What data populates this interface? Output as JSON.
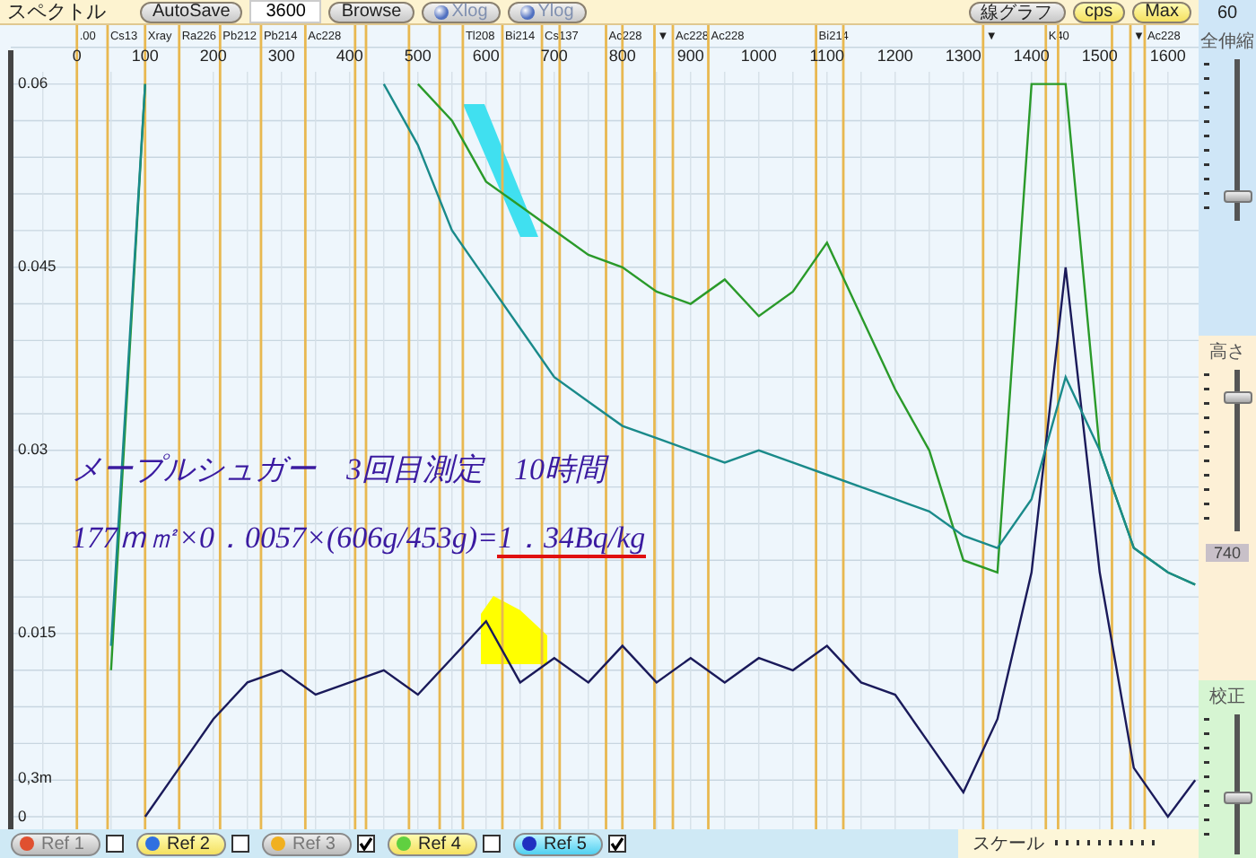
{
  "toolbar": {
    "title": "スペクトル",
    "controls": [
      {
        "kind": "button",
        "label": "AutoSave"
      },
      {
        "kind": "field",
        "value": "3600"
      },
      {
        "kind": "button",
        "label": "Browse"
      },
      {
        "kind": "radio",
        "label": "Xlog",
        "on": false
      },
      {
        "kind": "radio",
        "label": "Ylog",
        "on": false
      }
    ],
    "toggles": [
      {
        "label": "線グラフ",
        "on": false
      },
      {
        "label": "cps",
        "on": true
      },
      {
        "label": "Max",
        "on": true
      }
    ]
  },
  "spectrum": {
    "chart_data": {
      "type": "line",
      "grid": true,
      "x": [
        50,
        100,
        150,
        200,
        250,
        300,
        350,
        400,
        450,
        500,
        550,
        600,
        650,
        700,
        750,
        800,
        850,
        900,
        950,
        1000,
        1050,
        1100,
        1150,
        1200,
        1250,
        1300,
        1350,
        1400,
        1450,
        1500,
        1550,
        1600,
        1640
      ],
      "series": [
        {
          "color": "#1a1a5a",
          "values": [
            null,
            0.0,
            0.004,
            0.008,
            0.011,
            0.012,
            0.01,
            0.011,
            0.012,
            0.01,
            0.013,
            0.016,
            0.011,
            0.013,
            0.011,
            0.014,
            0.011,
            0.013,
            0.011,
            0.013,
            0.012,
            0.014,
            0.011,
            0.01,
            0.006,
            0.002,
            0.008,
            0.02,
            0.045,
            0.02,
            0.004,
            0.0,
            0.003
          ]
        },
        {
          "color": "#2a9a2a",
          "values": [
            0.012,
            0.06,
            null,
            null,
            null,
            null,
            null,
            null,
            null,
            0.06,
            0.057,
            0.052,
            0.05,
            0.048,
            0.046,
            0.045,
            0.043,
            0.042,
            0.044,
            0.041,
            0.043,
            0.047,
            0.041,
            0.035,
            0.03,
            0.021,
            0.02,
            0.06,
            0.06,
            0.03,
            0.022,
            0.02,
            0.019
          ]
        },
        {
          "color": "#1a8a8a",
          "values": [
            0.014,
            0.06,
            null,
            null,
            null,
            null,
            null,
            null,
            0.06,
            0.055,
            0.048,
            0.044,
            0.04,
            0.036,
            0.034,
            0.032,
            0.031,
            0.03,
            0.029,
            0.03,
            0.029,
            0.028,
            0.027,
            0.026,
            0.025,
            0.023,
            0.022,
            0.026,
            0.036,
            0.03,
            0.022,
            0.02,
            0.019
          ]
        }
      ],
      "xticks": [
        0,
        100,
        200,
        300,
        400,
        500,
        600,
        700,
        800,
        900,
        1000,
        1100,
        1200,
        1300,
        1400,
        1500,
        1600
      ],
      "yticks": [
        0,
        0.015,
        0.03,
        0.045,
        0.06
      ],
      "xlim": [
        -97,
        1645
      ],
      "ylim": [
        0,
        0.061
      ],
      "ref_lines": [
        {
          "axis": "x",
          "value": 0,
          "label": ".00"
        },
        {
          "axis": "x",
          "value": 45,
          "label": "Cs13"
        },
        {
          "axis": "x",
          "value": 100,
          "label": "Xray"
        },
        {
          "axis": "x",
          "value": 150,
          "label": "Ra226"
        },
        {
          "axis": "x",
          "value": 210,
          "label": "Pb212"
        },
        {
          "axis": "x",
          "value": 270,
          "label": "Pb214"
        },
        {
          "axis": "x",
          "value": 335,
          "label": "Ac228"
        },
        {
          "axis": "x",
          "value": 408
        },
        {
          "axis": "x",
          "value": 424
        },
        {
          "axis": "x",
          "value": 487
        },
        {
          "axis": "x",
          "value": 532
        },
        {
          "axis": "x",
          "value": 566,
          "label": "Tl208"
        },
        {
          "axis": "x",
          "value": 624,
          "label": "Bi214"
        },
        {
          "axis": "x",
          "value": 682,
          "label": "Cs137"
        },
        {
          "axis": "x",
          "value": 708
        },
        {
          "axis": "x",
          "value": 776,
          "label": "Ac228"
        },
        {
          "axis": "x",
          "value": 800
        },
        {
          "axis": "x",
          "value": 847,
          "label": "▼"
        },
        {
          "axis": "x",
          "value": 874,
          "label": "Ac228"
        },
        {
          "axis": "x",
          "value": 926,
          "label": "Ac228"
        },
        {
          "axis": "x",
          "value": 1084,
          "label": "Bi214"
        },
        {
          "axis": "x",
          "value": 1124
        },
        {
          "axis": "x",
          "value": 1329,
          "label": "▼"
        },
        {
          "axis": "x",
          "value": 1421,
          "label": "K40"
        },
        {
          "axis": "x",
          "value": 1439
        },
        {
          "axis": "x",
          "value": 1518
        },
        {
          "axis": "x",
          "value": 1545,
          "label": "▼"
        },
        {
          "axis": "x",
          "value": 1566,
          "label": "Ac228"
        }
      ]
    },
    "low_label": "0,3m",
    "note": {
      "title": "メープルシュガー　3回目測定　10時間",
      "formula": "177ｍ㎡×0．0057×(606g/453g)=",
      "result": "1．34Bq/kg"
    }
  },
  "side_panel": {
    "value": "60",
    "sliders": [
      {
        "kind": "zoom",
        "label": "全伸縮",
        "level": 0.12
      },
      {
        "kind": "height",
        "label": "高さ",
        "level": 0.85,
        "reading": "740"
      },
      {
        "kind": "calibration",
        "label": "校正",
        "level": 0.4
      }
    ]
  },
  "refs": [
    {
      "label": "Ref 1",
      "color": "#e05030",
      "active": false,
      "selected": false,
      "checked": false
    },
    {
      "label": "Ref 2",
      "color": "#3070e0",
      "active": true,
      "selected": false,
      "checked": false
    },
    {
      "label": "Ref 3",
      "color": "#f0b020",
      "active": false,
      "selected": false,
      "checked": true
    },
    {
      "label": "Ref 4",
      "color": "#60d040",
      "active": true,
      "selected": false,
      "checked": false
    },
    {
      "label": "Ref 5",
      "color": "#2030c0",
      "active": true,
      "selected": true,
      "checked": true
    }
  ],
  "scale_label": "スケール"
}
